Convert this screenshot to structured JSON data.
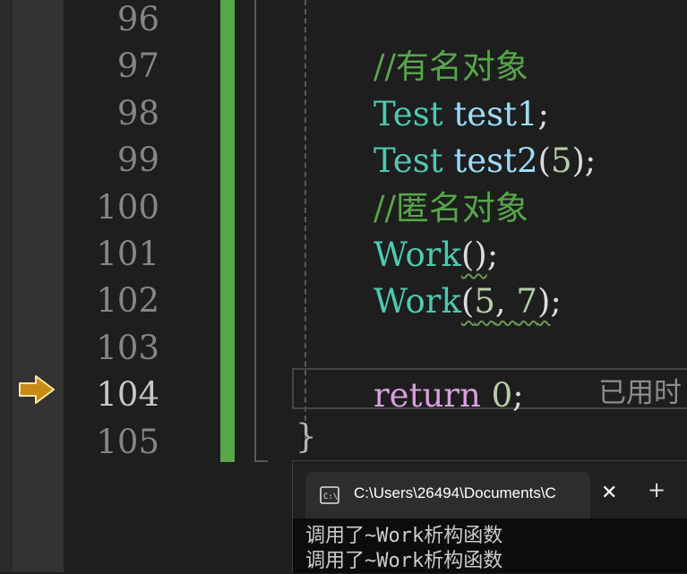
{
  "gutter": {
    "line_numbers": [
      "96",
      "97",
      "98",
      "99",
      "100",
      "101",
      "102",
      "103",
      "104",
      "105"
    ],
    "current_line": "104"
  },
  "code": {
    "lines": [
      {
        "num": "96",
        "tokens": []
      },
      {
        "num": "97",
        "tokens": [
          {
            "cls": "cmt",
            "text": "//有名对象"
          }
        ]
      },
      {
        "num": "98",
        "tokens": [
          {
            "cls": "type",
            "text": "Test"
          },
          {
            "cls": "punc",
            "text": " "
          },
          {
            "cls": "var",
            "text": "test1"
          },
          {
            "cls": "punc",
            "text": ";"
          }
        ]
      },
      {
        "num": "99",
        "tokens": [
          {
            "cls": "type",
            "text": "Test"
          },
          {
            "cls": "punc",
            "text": " "
          },
          {
            "cls": "var",
            "text": "test2"
          },
          {
            "cls": "punc",
            "text": "("
          },
          {
            "cls": "num",
            "text": "5"
          },
          {
            "cls": "punc",
            "text": ");"
          }
        ]
      },
      {
        "num": "100",
        "tokens": [
          {
            "cls": "cmt",
            "text": "//匿名对象"
          }
        ]
      },
      {
        "num": "101",
        "tokens": [
          {
            "cls": "type",
            "text": "Work"
          },
          {
            "cls": "punc squiggle",
            "text": "()"
          },
          {
            "cls": "punc",
            "text": ";"
          }
        ]
      },
      {
        "num": "102",
        "tokens": [
          {
            "cls": "type",
            "text": "Work"
          },
          {
            "cls": "punc squiggle",
            "text": "("
          },
          {
            "cls": "num squiggle",
            "text": "5"
          },
          {
            "cls": "punc squiggle",
            "text": ", "
          },
          {
            "cls": "num squiggle",
            "text": "7"
          },
          {
            "cls": "punc squiggle",
            "text": ")"
          },
          {
            "cls": "punc",
            "text": ";"
          }
        ]
      },
      {
        "num": "103",
        "tokens": []
      },
      {
        "num": "104",
        "tokens": [
          {
            "cls": "kw",
            "text": "return"
          },
          {
            "cls": "punc",
            "text": " "
          },
          {
            "cls": "num",
            "text": "0"
          },
          {
            "cls": "punc",
            "text": ";"
          }
        ]
      },
      {
        "num": "105",
        "tokens": []
      }
    ],
    "closing_brace": "}",
    "elapsed_hint": "已用时"
  },
  "console": {
    "tab_title": "C:\\Users\\26494\\Documents\\C",
    "close_glyph": "✕",
    "new_tab_glyph": "+",
    "output_lines": [
      "调用了~Work析构函数",
      "调用了~Work析构函数"
    ]
  },
  "colors": {
    "comment": "#57a64a",
    "type": "#4ec9b0",
    "variable": "#9cdcfe",
    "number": "#b5cea8",
    "keyword": "#d8a0df",
    "change_bar": "#57a64a",
    "breakpoint_arrow": "#c68b17"
  }
}
